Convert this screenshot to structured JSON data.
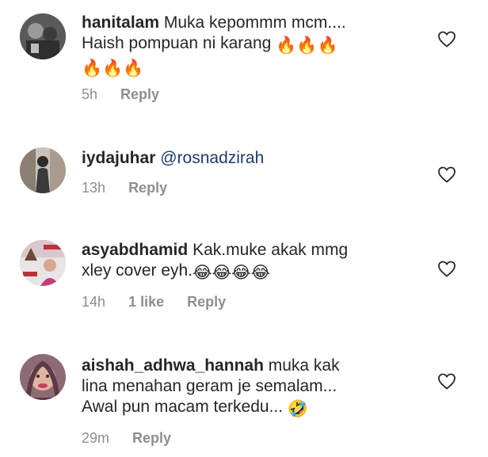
{
  "comments": [
    {
      "username": "hanitalam",
      "text": "Muka kepommm mcm....",
      "text2": "Haish pompuan ni karang",
      "emoji_line1": "🔥🔥🔥",
      "emoji_line2": "🔥🔥🔥",
      "time": "5h",
      "reply": "Reply"
    },
    {
      "username": "iydajuhar",
      "mention": "@rosnadzirah",
      "time": "13h",
      "reply": "Reply"
    },
    {
      "username": "asyabdhamid",
      "text": "Kak.muke akak mmg",
      "text2": "xley cover eyh.",
      "emoji": "😂😂😂😂",
      "time": "14h",
      "likes": "1 like",
      "reply": "Reply"
    },
    {
      "username": "aishah_adhwa_hannah",
      "text": "muka kak",
      "text2": "lina menahan geram je semalam...",
      "text3": "Awal pun macam terkedu...",
      "emoji": "🤣",
      "time": "29m",
      "reply": "Reply"
    }
  ],
  "icons": {
    "like": "heart-outline-icon"
  },
  "colors": {
    "text": "#262626",
    "meta": "#8e8e8e",
    "mention": "#1d3a6e"
  }
}
